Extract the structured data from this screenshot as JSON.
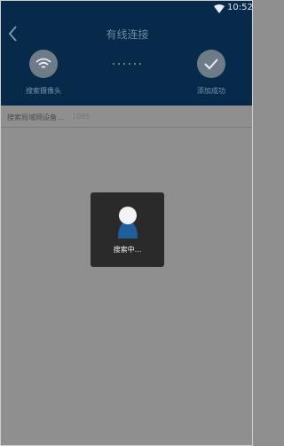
{
  "status_bar": {
    "time": "10:52"
  },
  "header": {
    "title": "有线连接",
    "steps": [
      {
        "label": "搜索摄像头",
        "icon": "wifi-icon"
      },
      {
        "label": "添加成功",
        "icon": "checkmark-icon"
      }
    ]
  },
  "search_row": {
    "text": "搜索局域网设备...",
    "count": "1085"
  },
  "toast": {
    "text": "搜索中..."
  },
  "colors": {
    "header_bg": "#072a4b",
    "overlay": "#8f8f8f",
    "toast_bg": "#2a2a2a",
    "avatar_blue": "#1f5f9c"
  }
}
